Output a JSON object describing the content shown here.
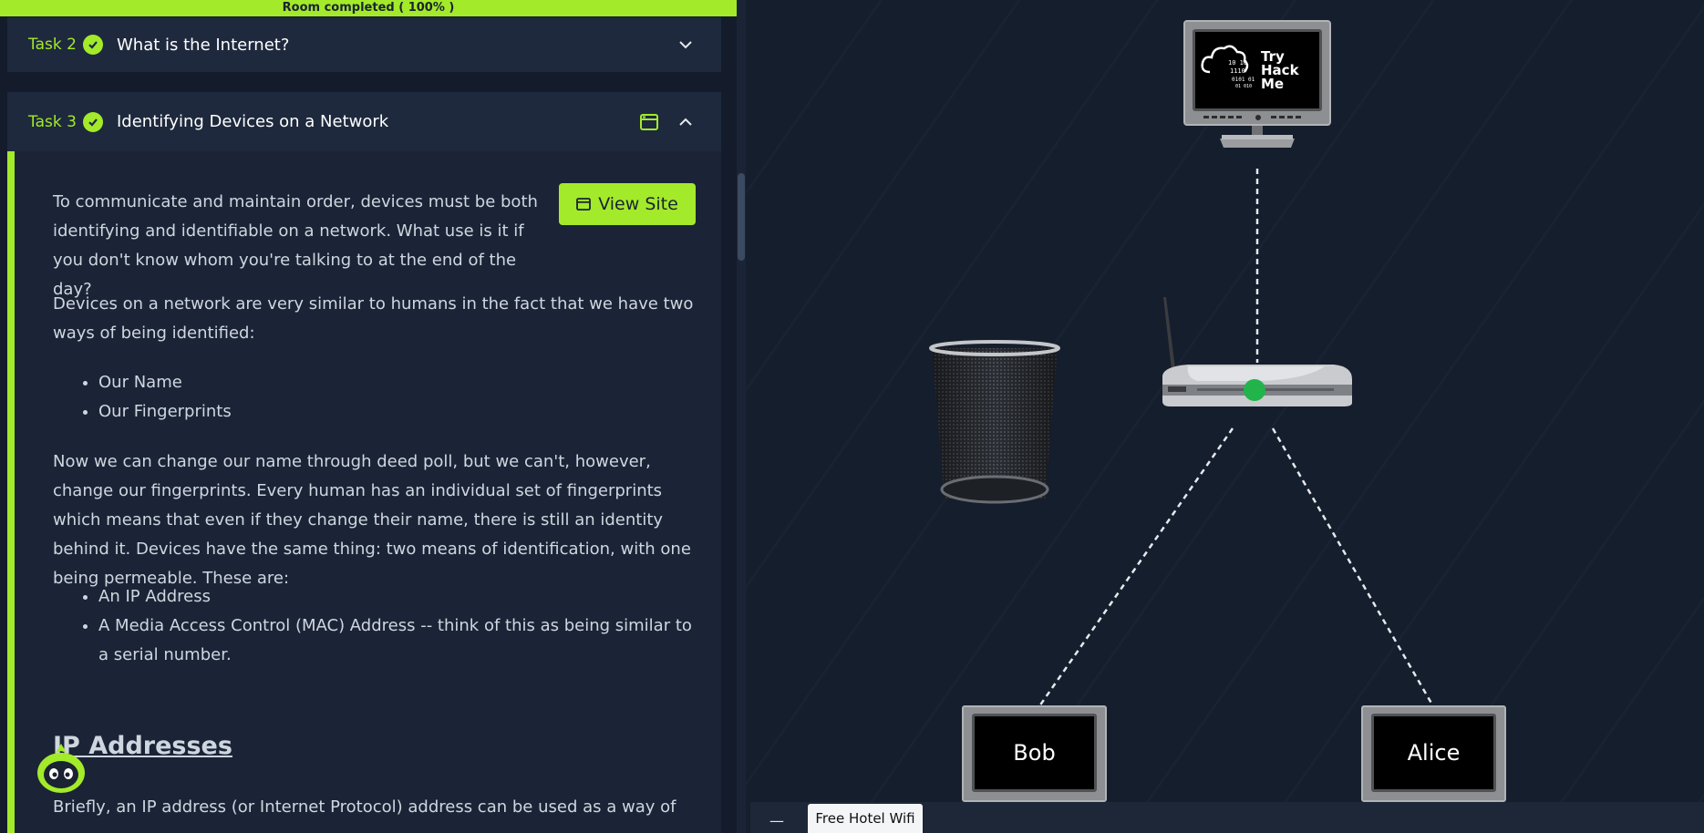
{
  "progress": {
    "label": "Room completed ( 100% )",
    "percent": 100
  },
  "tasks": [
    {
      "number": "Task 2",
      "title": "What is the Internet?",
      "completed": true,
      "expanded": false
    },
    {
      "number": "Task 3",
      "title": "Identifying Devices on a Network",
      "completed": true,
      "expanded": true
    }
  ],
  "task3": {
    "view_site_label": "View Site",
    "paragraph1": "To communicate and maintain order, devices must be both identifying and identifiable on a network. What use is it if you don't know whom you're talking to at the end of the day?",
    "paragraph2": "Devices on a network are very similar to humans in the fact that we have two ways of being identified:",
    "list1": [
      "Our Name",
      "Our Fingerprints"
    ],
    "paragraph3": "Now we can change our name through deed poll, but we can't, however, change our fingerprints. Every human has an individual set of fingerprints which means that even if they change their name, there is still an identity behind it. Devices have the same thing: two means of identification, with one being permeable. These are:",
    "list2": [
      "An IP Address",
      "A Media Access Control (MAC) Address -- think of this as being similar to a serial number."
    ],
    "heading": "IP Addresses",
    "paragraph4": "Briefly, an IP address (or Internet Protocol) address can be used as a way of"
  },
  "network": {
    "server_logo": [
      "Try",
      "Hack",
      "Me"
    ],
    "server_binary": [
      "10 10",
      "1110",
      "0101 01",
      "01 010"
    ],
    "hosts": [
      "Bob",
      "Alice"
    ],
    "router_status_color": "#22b34a"
  },
  "bottom_bar": {
    "minimize_label": "—",
    "tab_label": "Free Hotel Wifi"
  },
  "colors": {
    "accent": "#a3ea2a",
    "panel": "#1e293d",
    "background": "#141c2b"
  }
}
